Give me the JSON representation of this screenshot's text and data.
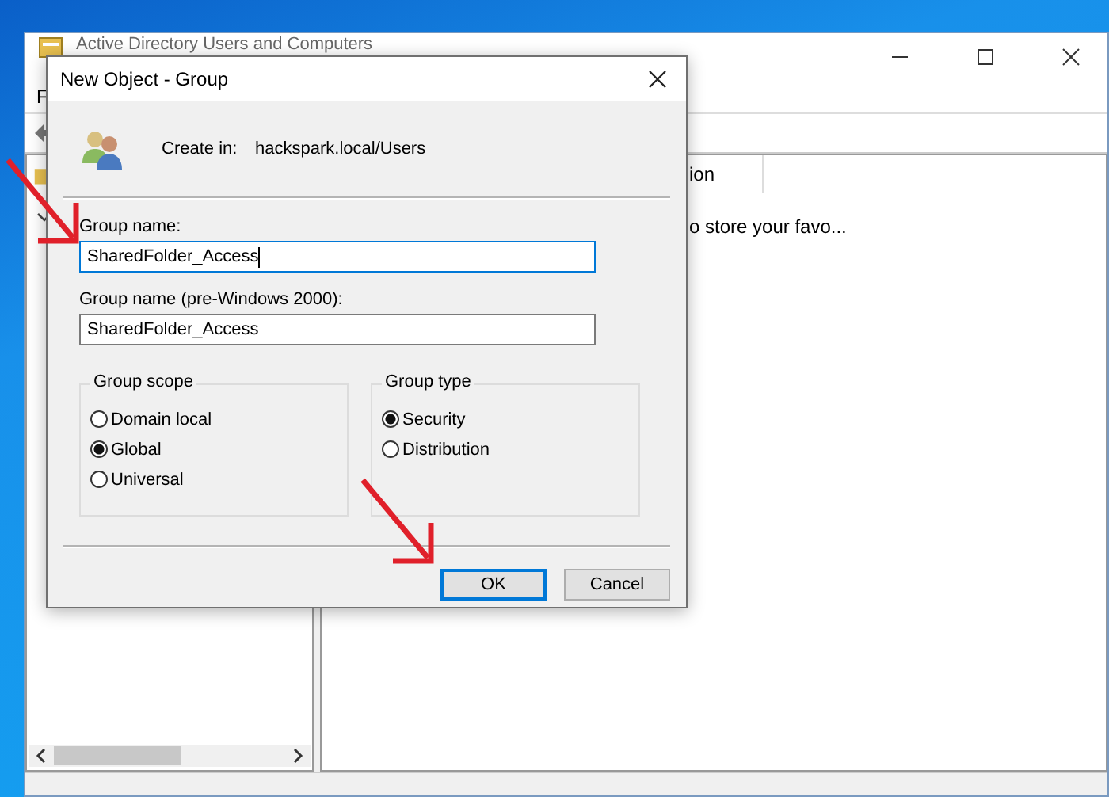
{
  "background_window": {
    "title": "Active Directory Users and Computers",
    "menu": [
      "F"
    ],
    "list_header": "ion",
    "list_text": "o store your favo..."
  },
  "dialog": {
    "title": "New Object - Group",
    "create_in_label": "Create in:",
    "create_in_path": "hackspark.local/Users",
    "fields": [
      {
        "label": "Group name:",
        "value": "SharedFolder_Access",
        "focused": true
      },
      {
        "label": "Group name (pre-Windows 2000):",
        "value": "SharedFolder_Access",
        "focused": false
      }
    ],
    "groups": [
      {
        "title": "Group scope",
        "options": [
          {
            "label": "Domain local",
            "selected": false
          },
          {
            "label": "Global",
            "selected": true
          },
          {
            "label": "Universal",
            "selected": false
          }
        ]
      },
      {
        "title": "Group type",
        "options": [
          {
            "label": "Security",
            "selected": true
          },
          {
            "label": "Distribution",
            "selected": false
          }
        ]
      }
    ],
    "buttons": [
      {
        "label": "OK",
        "default": true
      },
      {
        "label": "Cancel",
        "default": false
      }
    ]
  }
}
